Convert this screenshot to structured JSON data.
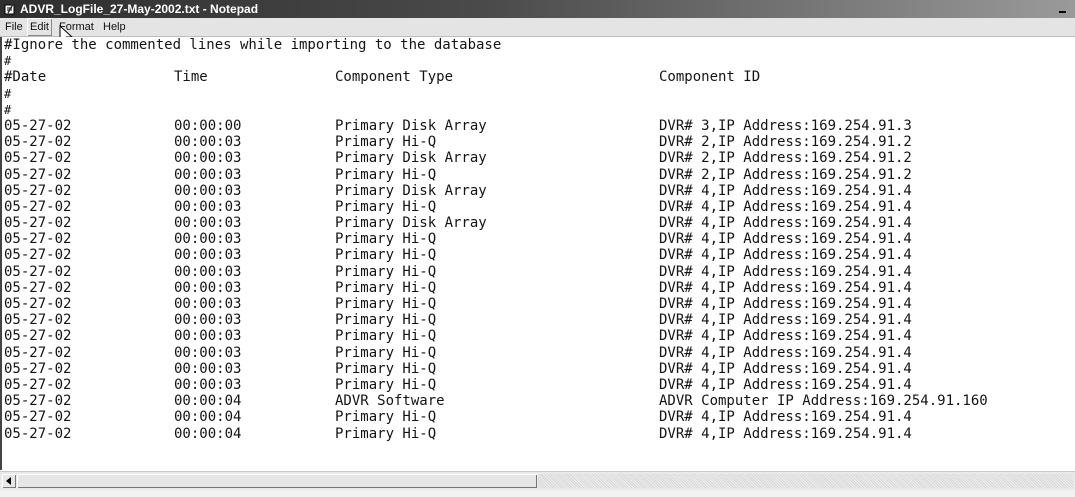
{
  "window": {
    "title": "ADVR_LogFile_27-May-2002.txt - Notepad",
    "icon": "notepad-icon"
  },
  "menu": [
    "File",
    "Edit",
    "Format",
    "Help"
  ],
  "document": {
    "lines": [
      {
        "text": "#Ignore the commented lines while importing to the database"
      },
      {
        "text": "#",
        "small": true
      },
      {
        "cols": [
          "#Date",
          "Time",
          "Component Type",
          "Component ID"
        ]
      },
      {
        "text": "#",
        "small": true
      },
      {
        "text": "#",
        "small": true
      },
      {
        "cols": [
          "05-27-02",
          "00:00:00",
          "Primary Disk Array",
          "DVR# 3,IP Address:169.254.91.3"
        ]
      },
      {
        "cols": [
          "05-27-02",
          "00:00:03",
          "Primary Hi-Q",
          "DVR# 2,IP Address:169.254.91.2"
        ]
      },
      {
        "cols": [
          "05-27-02",
          "00:00:03",
          "Primary Disk Array",
          "DVR# 2,IP Address:169.254.91.2"
        ]
      },
      {
        "cols": [
          "05-27-02",
          "00:00:03",
          "Primary Hi-Q",
          "DVR# 2,IP Address:169.254.91.2"
        ]
      },
      {
        "cols": [
          "05-27-02",
          "00:00:03",
          "Primary Disk Array",
          "DVR# 4,IP Address:169.254.91.4"
        ]
      },
      {
        "cols": [
          "05-27-02",
          "00:00:03",
          "Primary Hi-Q",
          "DVR# 4,IP Address:169.254.91.4"
        ]
      },
      {
        "cols": [
          "05-27-02",
          "00:00:03",
          "Primary Disk Array",
          "DVR# 4,IP Address:169.254.91.4"
        ]
      },
      {
        "cols": [
          "05-27-02",
          "00:00:03",
          "Primary Hi-Q",
          "DVR# 4,IP Address:169.254.91.4"
        ]
      },
      {
        "cols": [
          "05-27-02",
          "00:00:03",
          "Primary Hi-Q",
          "DVR# 4,IP Address:169.254.91.4"
        ]
      },
      {
        "cols": [
          "05-27-02",
          "00:00:03",
          "Primary Hi-Q",
          "DVR# 4,IP Address:169.254.91.4"
        ]
      },
      {
        "cols": [
          "05-27-02",
          "00:00:03",
          "Primary Hi-Q",
          "DVR# 4,IP Address:169.254.91.4"
        ]
      },
      {
        "cols": [
          "05-27-02",
          "00:00:03",
          "Primary Hi-Q",
          "DVR# 4,IP Address:169.254.91.4"
        ]
      },
      {
        "cols": [
          "05-27-02",
          "00:00:03",
          "Primary Hi-Q",
          "DVR# 4,IP Address:169.254.91.4"
        ]
      },
      {
        "cols": [
          "05-27-02",
          "00:00:03",
          "Primary Hi-Q",
          "DVR# 4,IP Address:169.254.91.4"
        ]
      },
      {
        "cols": [
          "05-27-02",
          "00:00:03",
          "Primary Hi-Q",
          "DVR# 4,IP Address:169.254.91.4"
        ]
      },
      {
        "cols": [
          "05-27-02",
          "00:00:03",
          "Primary Hi-Q",
          "DVR# 4,IP Address:169.254.91.4"
        ]
      },
      {
        "cols": [
          "05-27-02",
          "00:00:03",
          "Primary Hi-Q",
          "DVR# 4,IP Address:169.254.91.4"
        ]
      },
      {
        "cols": [
          "05-27-02",
          "00:00:04",
          "ADVR Software",
          "ADVR Computer IP Address:169.254.91.160"
        ]
      },
      {
        "cols": [
          "05-27-02",
          "00:00:04",
          "Primary Hi-Q",
          "DVR# 4,IP Address:169.254.91.4"
        ]
      },
      {
        "cols": [
          "05-27-02",
          "00:00:04",
          "Primary Hi-Q",
          "DVR# 4,IP Address:169.254.91.4"
        ]
      }
    ]
  }
}
